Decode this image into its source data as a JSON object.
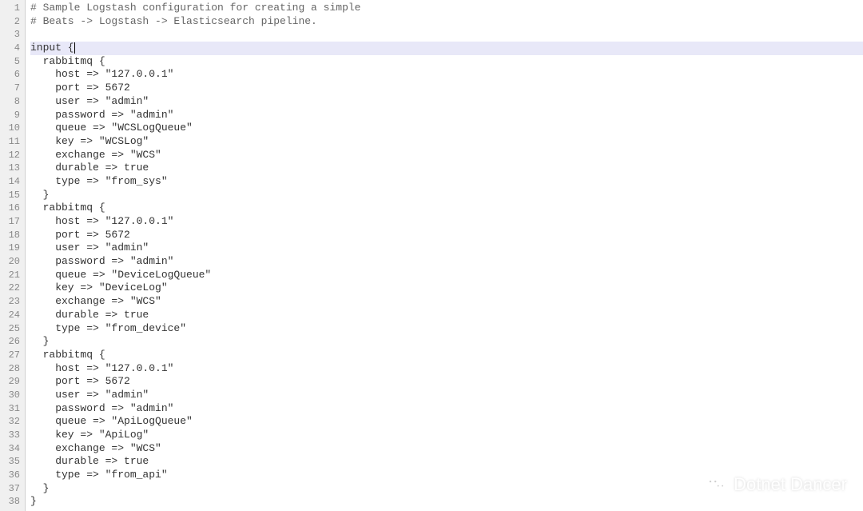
{
  "editor": {
    "highlightedLine": 4,
    "lines": [
      {
        "num": 1,
        "text": "# Sample Logstash configuration for creating a simple",
        "cls": "comment"
      },
      {
        "num": 2,
        "text": "# Beats -> Logstash -> Elasticsearch pipeline.",
        "cls": "comment"
      },
      {
        "num": 3,
        "text": "",
        "cls": ""
      },
      {
        "num": 4,
        "text": "input {",
        "cls": "",
        "cursor": true
      },
      {
        "num": 5,
        "text": "  rabbitmq {",
        "cls": ""
      },
      {
        "num": 6,
        "text": "    host => \"127.0.0.1\"",
        "cls": ""
      },
      {
        "num": 7,
        "text": "    port => 5672",
        "cls": ""
      },
      {
        "num": 8,
        "text": "    user => \"admin\"",
        "cls": ""
      },
      {
        "num": 9,
        "text": "    password => \"admin\"",
        "cls": ""
      },
      {
        "num": 10,
        "text": "    queue => \"WCSLogQueue\"",
        "cls": ""
      },
      {
        "num": 11,
        "text": "    key => \"WCSLog\"",
        "cls": ""
      },
      {
        "num": 12,
        "text": "    exchange => \"WCS\"",
        "cls": ""
      },
      {
        "num": 13,
        "text": "    durable => true",
        "cls": ""
      },
      {
        "num": 14,
        "text": "    type => \"from_sys\"",
        "cls": ""
      },
      {
        "num": 15,
        "text": "  }",
        "cls": ""
      },
      {
        "num": 16,
        "text": "  rabbitmq {",
        "cls": ""
      },
      {
        "num": 17,
        "text": "    host => \"127.0.0.1\"",
        "cls": ""
      },
      {
        "num": 18,
        "text": "    port => 5672",
        "cls": ""
      },
      {
        "num": 19,
        "text": "    user => \"admin\"",
        "cls": ""
      },
      {
        "num": 20,
        "text": "    password => \"admin\"",
        "cls": ""
      },
      {
        "num": 21,
        "text": "    queue => \"DeviceLogQueue\"",
        "cls": ""
      },
      {
        "num": 22,
        "text": "    key => \"DeviceLog\"",
        "cls": ""
      },
      {
        "num": 23,
        "text": "    exchange => \"WCS\"",
        "cls": ""
      },
      {
        "num": 24,
        "text": "    durable => true",
        "cls": ""
      },
      {
        "num": 25,
        "text": "    type => \"from_device\"",
        "cls": ""
      },
      {
        "num": 26,
        "text": "  }",
        "cls": ""
      },
      {
        "num": 27,
        "text": "  rabbitmq {",
        "cls": ""
      },
      {
        "num": 28,
        "text": "    host => \"127.0.0.1\"",
        "cls": ""
      },
      {
        "num": 29,
        "text": "    port => 5672",
        "cls": ""
      },
      {
        "num": 30,
        "text": "    user => \"admin\"",
        "cls": ""
      },
      {
        "num": 31,
        "text": "    password => \"admin\"",
        "cls": ""
      },
      {
        "num": 32,
        "text": "    queue => \"ApiLogQueue\"",
        "cls": ""
      },
      {
        "num": 33,
        "text": "    key => \"ApiLog\"",
        "cls": ""
      },
      {
        "num": 34,
        "text": "    exchange => \"WCS\"",
        "cls": ""
      },
      {
        "num": 35,
        "text": "    durable => true",
        "cls": ""
      },
      {
        "num": 36,
        "text": "    type => \"from_api\"",
        "cls": ""
      },
      {
        "num": 37,
        "text": "  }",
        "cls": ""
      },
      {
        "num": 38,
        "text": "}",
        "cls": ""
      }
    ]
  },
  "watermark": {
    "text": "Dotnet Dancer"
  }
}
